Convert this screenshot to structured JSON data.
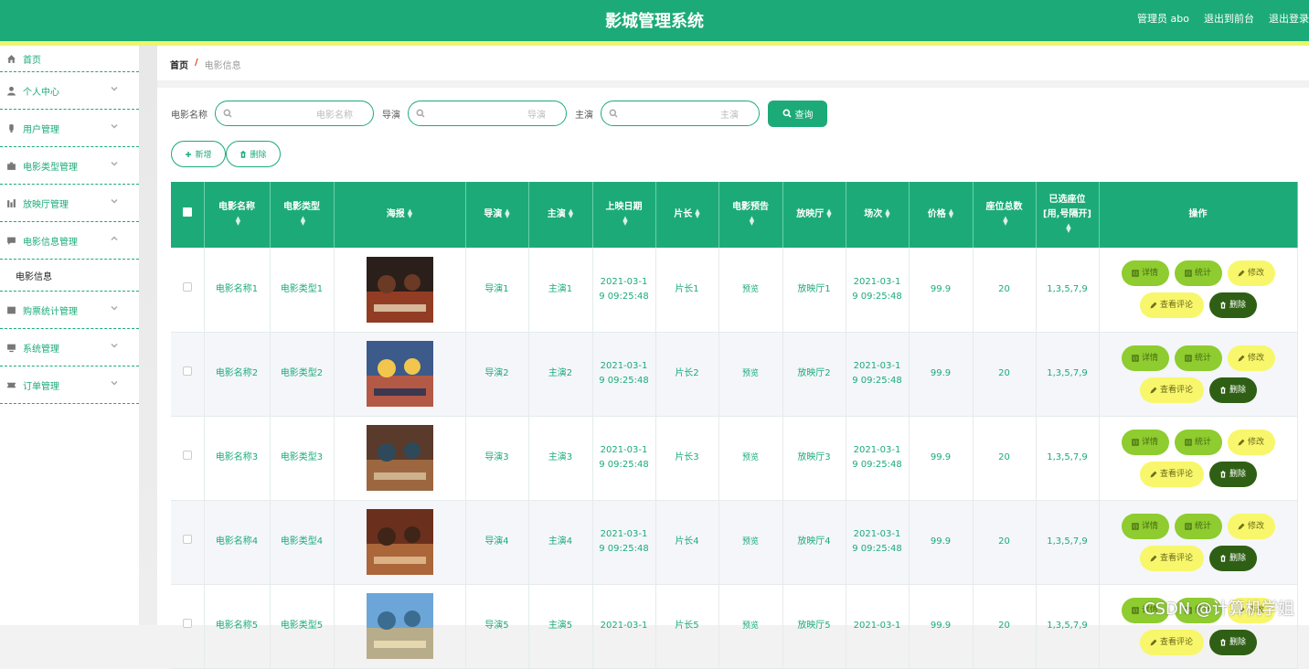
{
  "header": {
    "title": "影城管理系统",
    "admin": "管理员 abo",
    "back_front": "退出到前台",
    "logout": "退出登录"
  },
  "sidebar": {
    "items": [
      {
        "label": "首页",
        "icon": "home-icon"
      },
      {
        "label": "个人中心",
        "icon": "user-icon"
      },
      {
        "label": "用户管理",
        "icon": "user-manage-icon"
      },
      {
        "label": "电影类型管理",
        "icon": "briefcase-icon"
      },
      {
        "label": "放映厅管理",
        "icon": "chart-icon"
      },
      {
        "label": "电影信息管理",
        "icon": "message-icon"
      }
    ],
    "sub_item": "电影信息",
    "items2": [
      {
        "label": "购票统计管理",
        "icon": "ticket-icon"
      },
      {
        "label": "系统管理",
        "icon": "monitor-icon"
      },
      {
        "label": "订单管理",
        "icon": "ticket-icon"
      }
    ]
  },
  "breadcrumb": {
    "home": "首页",
    "sep": "/",
    "current": "电影信息"
  },
  "search": {
    "name_label": "电影名称",
    "name_placeholder": "电影名称",
    "director_label": "导演",
    "director_placeholder": "导演",
    "actor_label": "主演",
    "actor_placeholder": "主演",
    "query_label": "查询"
  },
  "actions": {
    "add": "新增",
    "delete": "删除"
  },
  "table": {
    "headers": [
      "电影名称",
      "电影类型",
      "海报",
      "导演",
      "主演",
      "上映日期",
      "片长",
      "电影预告",
      "放映厅",
      "场次",
      "价格",
      "座位总数",
      "已选座位[用,号隔开]",
      "操作"
    ],
    "seat_header_line1": "已选座位",
    "seat_header_line2": "[用,号隔开]",
    "op_labels": {
      "detail": "详情",
      "stats": "统计",
      "edit": "修改",
      "comments": "查看评论",
      "delete": "删除"
    },
    "rows": [
      {
        "name": "电影名称1",
        "type": "电影类型1",
        "director": "导演1",
        "actor": "主演1",
        "date1": "2021-03-1",
        "date2": "9 09:25:48",
        "length": "片长1",
        "preview": "预览",
        "hall": "放映厅1",
        "show1": "2021-03-1",
        "show2": "9 09:25:48",
        "price": "99.9",
        "seats": "20",
        "selected": "1,3,5,7,9"
      },
      {
        "name": "电影名称2",
        "type": "电影类型2",
        "director": "导演2",
        "actor": "主演2",
        "date1": "2021-03-1",
        "date2": "9 09:25:48",
        "length": "片长2",
        "preview": "预览",
        "hall": "放映厅2",
        "show1": "2021-03-1",
        "show2": "9 09:25:48",
        "price": "99.9",
        "seats": "20",
        "selected": "1,3,5,7,9"
      },
      {
        "name": "电影名称3",
        "type": "电影类型3",
        "director": "导演3",
        "actor": "主演3",
        "date1": "2021-03-1",
        "date2": "9 09:25:48",
        "length": "片长3",
        "preview": "预览",
        "hall": "放映厅3",
        "show1": "2021-03-1",
        "show2": "9 09:25:48",
        "price": "99.9",
        "seats": "20",
        "selected": "1,3,5,7,9"
      },
      {
        "name": "电影名称4",
        "type": "电影类型4",
        "director": "导演4",
        "actor": "主演4",
        "date1": "2021-03-1",
        "date2": "9 09:25:48",
        "length": "片长4",
        "preview": "预览",
        "hall": "放映厅4",
        "show1": "2021-03-1",
        "show2": "9 09:25:48",
        "price": "99.9",
        "seats": "20",
        "selected": "1,3,5,7,9"
      },
      {
        "name": "电影名称5",
        "type": "电影类型5",
        "director": "导演5",
        "actor": "主演5",
        "date1": "2021-03-1",
        "date2": "",
        "length": "片长5",
        "preview": "预览",
        "hall": "放映厅5",
        "show1": "2021-03-1",
        "show2": "",
        "price": "99.9",
        "seats": "20",
        "selected": "1,3,5,7,9"
      }
    ]
  },
  "watermark": "CSDN @计算机学姐",
  "colors": {
    "primary": "#1cab78",
    "accent_bar": "#ecf56b"
  }
}
